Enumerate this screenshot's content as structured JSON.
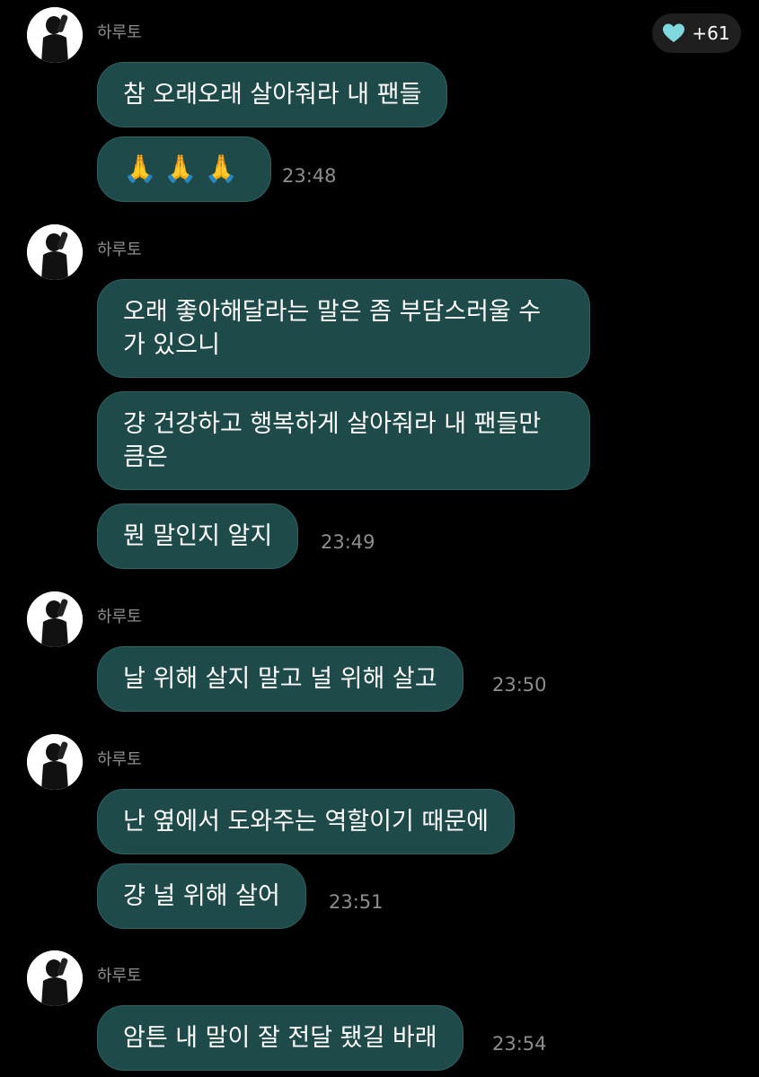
{
  "like_badge": {
    "icon": "heart-icon",
    "color": "#7fd8de",
    "count": "+61"
  },
  "messages": [
    {
      "sender": "하루토",
      "bubbles": [
        {
          "text": "참 오래오래 살아줘라 내 팬들"
        },
        {
          "text": "🙏🙏🙏",
          "time": "23:48"
        }
      ]
    },
    {
      "sender": "하루토",
      "bubbles": [
        {
          "text": "오래 좋아해달라는 말은 좀 부담스러울 수 가 있으니"
        },
        {
          "text": "걍 건강하고 행복하게 살아줘라 내 팬들만 큼은"
        },
        {
          "text": "뭔 말인지 알지",
          "time": "23:49"
        }
      ]
    },
    {
      "sender": "하루토",
      "bubbles": [
        {
          "text": "날 위해 살지 말고 널 위해 살고",
          "time": "23:50"
        }
      ]
    },
    {
      "sender": "하루토",
      "bubbles": [
        {
          "text": "난 옆에서 도와주는 역할이기 때문에"
        },
        {
          "text": "걍 널 위해 살어",
          "time": "23:51"
        }
      ]
    },
    {
      "sender": "하루토",
      "bubbles": [
        {
          "text": "암튼 내 말이 잘 전달 됐길 바래",
          "time": "23:54"
        }
      ]
    }
  ]
}
